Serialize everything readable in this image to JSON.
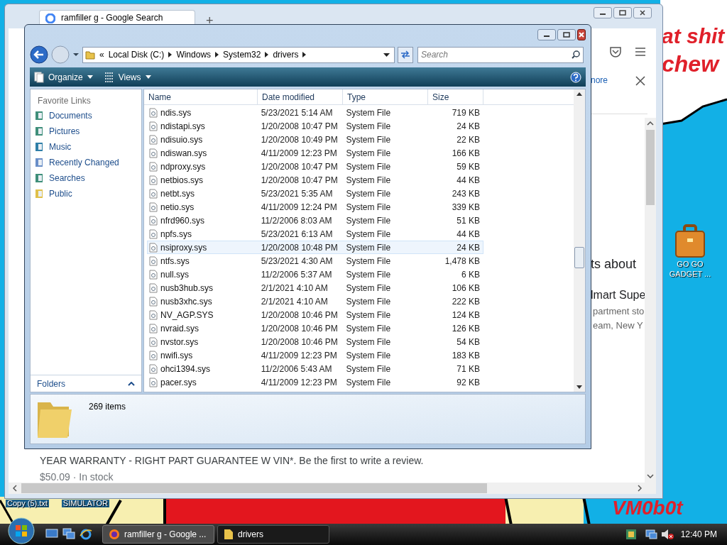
{
  "desktop": {
    "wallpaper_texts": [
      "at shit",
      "chew",
      "VM0b0t"
    ],
    "icons": [
      {
        "label": "GO GO GADGET ..."
      },
      {
        "label": "Copy (5).txt"
      },
      {
        "label": "SIMULATOR"
      }
    ]
  },
  "browser": {
    "tab_title": "ramfiller g - Google Search",
    "new_tab": "+",
    "link_text": "nore",
    "snippets": [
      "ts about",
      "lmart Supe",
      "partment sto",
      "eam, New Y"
    ],
    "product_text": "YEAR WARRANTY - RIGHT PART GUARANTEE W VIN*. Be the first to write a review.",
    "price_line": "$50.09 · In stock"
  },
  "explorer": {
    "overflow_mark": "«",
    "breadcrumb": [
      "Local Disk (C:)",
      "Windows",
      "System32",
      "drivers"
    ],
    "search_placeholder": "Search",
    "toolbar": [
      "Organize",
      "Views"
    ],
    "nav_header": "Favorite Links",
    "favorites": [
      "Documents",
      "Pictures",
      "Music",
      "Recently Changed",
      "Searches",
      "Public"
    ],
    "folders_label": "Folders",
    "columns": [
      "Name",
      "Date modified",
      "Type",
      "Size"
    ],
    "rows": [
      {
        "name": "ndis.sys",
        "date": "5/23/2021 5:14 AM",
        "type": "System File",
        "size": "719 KB",
        "highlighted": false
      },
      {
        "name": "ndistapi.sys",
        "date": "1/20/2008 10:47 PM",
        "type": "System File",
        "size": "24 KB",
        "highlighted": false
      },
      {
        "name": "ndisuio.sys",
        "date": "1/20/2008 10:49 PM",
        "type": "System File",
        "size": "22 KB",
        "highlighted": false
      },
      {
        "name": "ndiswan.sys",
        "date": "4/11/2009 12:23 PM",
        "type": "System File",
        "size": "166 KB",
        "highlighted": false
      },
      {
        "name": "ndproxy.sys",
        "date": "1/20/2008 10:47 PM",
        "type": "System File",
        "size": "59 KB",
        "highlighted": false
      },
      {
        "name": "netbios.sys",
        "date": "1/20/2008 10:47 PM",
        "type": "System File",
        "size": "44 KB",
        "highlighted": false
      },
      {
        "name": "netbt.sys",
        "date": "5/23/2021 5:35 AM",
        "type": "System File",
        "size": "243 KB",
        "highlighted": false
      },
      {
        "name": "netio.sys",
        "date": "4/11/2009 12:24 PM",
        "type": "System File",
        "size": "339 KB",
        "highlighted": false
      },
      {
        "name": "nfrd960.sys",
        "date": "11/2/2006 8:03 AM",
        "type": "System File",
        "size": "51 KB",
        "highlighted": false
      },
      {
        "name": "npfs.sys",
        "date": "5/23/2021 6:13 AM",
        "type": "System File",
        "size": "44 KB",
        "highlighted": false
      },
      {
        "name": "nsiproxy.sys",
        "date": "1/20/2008 10:48 PM",
        "type": "System File",
        "size": "24 KB",
        "highlighted": true
      },
      {
        "name": "ntfs.sys",
        "date": "5/23/2021 4:30 AM",
        "type": "System File",
        "size": "1,478 KB",
        "highlighted": false
      },
      {
        "name": "null.sys",
        "date": "11/2/2006 5:37 AM",
        "type": "System File",
        "size": "6 KB",
        "highlighted": false
      },
      {
        "name": "nusb3hub.sys",
        "date": "2/1/2021 4:10 AM",
        "type": "System File",
        "size": "106 KB",
        "highlighted": false
      },
      {
        "name": "nusb3xhc.sys",
        "date": "2/1/2021 4:10 AM",
        "type": "System File",
        "size": "222 KB",
        "highlighted": false
      },
      {
        "name": "NV_AGP.SYS",
        "date": "1/20/2008 10:46 PM",
        "type": "System File",
        "size": "124 KB",
        "highlighted": false
      },
      {
        "name": "nvraid.sys",
        "date": "1/20/2008 10:46 PM",
        "type": "System File",
        "size": "126 KB",
        "highlighted": false
      },
      {
        "name": "nvstor.sys",
        "date": "1/20/2008 10:46 PM",
        "type": "System File",
        "size": "54 KB",
        "highlighted": false
      },
      {
        "name": "nwifi.sys",
        "date": "4/11/2009 12:23 PM",
        "type": "System File",
        "size": "183 KB",
        "highlighted": false
      },
      {
        "name": "ohci1394.sys",
        "date": "11/2/2006 5:43 AM",
        "type": "System File",
        "size": "71 KB",
        "highlighted": false
      },
      {
        "name": "pacer.sys",
        "date": "4/11/2009 12:23 PM",
        "type": "System File",
        "size": "92 KB",
        "highlighted": false
      }
    ],
    "status": "269 items"
  },
  "taskbar": {
    "tasks": [
      {
        "label": "ramfiller g - Google ...",
        "selected": true
      },
      {
        "label": "drivers",
        "selected": false
      }
    ],
    "clock": "12:40 PM"
  }
}
